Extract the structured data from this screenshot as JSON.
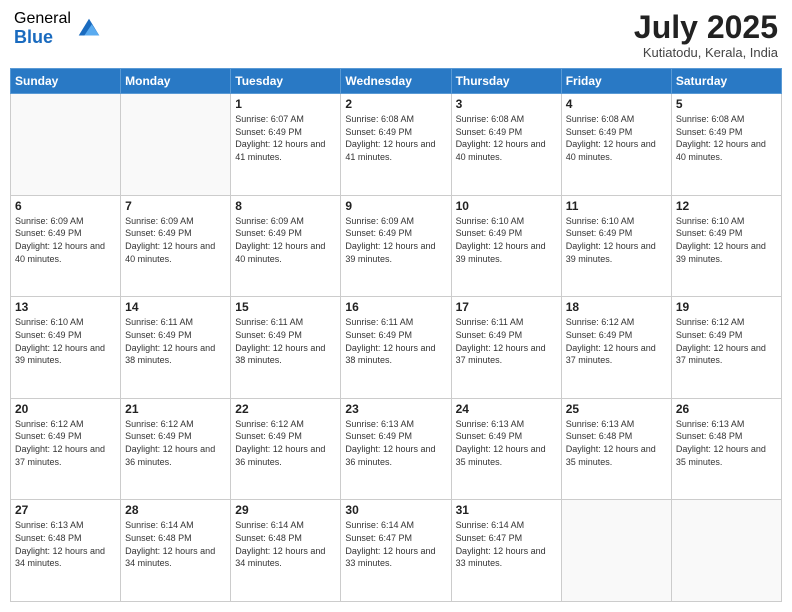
{
  "logo": {
    "general": "General",
    "blue": "Blue"
  },
  "header": {
    "month": "July 2025",
    "location": "Kutiatodu, Kerala, India"
  },
  "days": [
    "Sunday",
    "Monday",
    "Tuesday",
    "Wednesday",
    "Thursday",
    "Friday",
    "Saturday"
  ],
  "weeks": [
    [
      {
        "day": "",
        "sunrise": "",
        "sunset": "",
        "daylight": ""
      },
      {
        "day": "",
        "sunrise": "",
        "sunset": "",
        "daylight": ""
      },
      {
        "day": "1",
        "sunrise": "Sunrise: 6:07 AM",
        "sunset": "Sunset: 6:49 PM",
        "daylight": "Daylight: 12 hours and 41 minutes."
      },
      {
        "day": "2",
        "sunrise": "Sunrise: 6:08 AM",
        "sunset": "Sunset: 6:49 PM",
        "daylight": "Daylight: 12 hours and 41 minutes."
      },
      {
        "day": "3",
        "sunrise": "Sunrise: 6:08 AM",
        "sunset": "Sunset: 6:49 PM",
        "daylight": "Daylight: 12 hours and 40 minutes."
      },
      {
        "day": "4",
        "sunrise": "Sunrise: 6:08 AM",
        "sunset": "Sunset: 6:49 PM",
        "daylight": "Daylight: 12 hours and 40 minutes."
      },
      {
        "day": "5",
        "sunrise": "Sunrise: 6:08 AM",
        "sunset": "Sunset: 6:49 PM",
        "daylight": "Daylight: 12 hours and 40 minutes."
      }
    ],
    [
      {
        "day": "6",
        "sunrise": "Sunrise: 6:09 AM",
        "sunset": "Sunset: 6:49 PM",
        "daylight": "Daylight: 12 hours and 40 minutes."
      },
      {
        "day": "7",
        "sunrise": "Sunrise: 6:09 AM",
        "sunset": "Sunset: 6:49 PM",
        "daylight": "Daylight: 12 hours and 40 minutes."
      },
      {
        "day": "8",
        "sunrise": "Sunrise: 6:09 AM",
        "sunset": "Sunset: 6:49 PM",
        "daylight": "Daylight: 12 hours and 40 minutes."
      },
      {
        "day": "9",
        "sunrise": "Sunrise: 6:09 AM",
        "sunset": "Sunset: 6:49 PM",
        "daylight": "Daylight: 12 hours and 39 minutes."
      },
      {
        "day": "10",
        "sunrise": "Sunrise: 6:10 AM",
        "sunset": "Sunset: 6:49 PM",
        "daylight": "Daylight: 12 hours and 39 minutes."
      },
      {
        "day": "11",
        "sunrise": "Sunrise: 6:10 AM",
        "sunset": "Sunset: 6:49 PM",
        "daylight": "Daylight: 12 hours and 39 minutes."
      },
      {
        "day": "12",
        "sunrise": "Sunrise: 6:10 AM",
        "sunset": "Sunset: 6:49 PM",
        "daylight": "Daylight: 12 hours and 39 minutes."
      }
    ],
    [
      {
        "day": "13",
        "sunrise": "Sunrise: 6:10 AM",
        "sunset": "Sunset: 6:49 PM",
        "daylight": "Daylight: 12 hours and 39 minutes."
      },
      {
        "day": "14",
        "sunrise": "Sunrise: 6:11 AM",
        "sunset": "Sunset: 6:49 PM",
        "daylight": "Daylight: 12 hours and 38 minutes."
      },
      {
        "day": "15",
        "sunrise": "Sunrise: 6:11 AM",
        "sunset": "Sunset: 6:49 PM",
        "daylight": "Daylight: 12 hours and 38 minutes."
      },
      {
        "day": "16",
        "sunrise": "Sunrise: 6:11 AM",
        "sunset": "Sunset: 6:49 PM",
        "daylight": "Daylight: 12 hours and 38 minutes."
      },
      {
        "day": "17",
        "sunrise": "Sunrise: 6:11 AM",
        "sunset": "Sunset: 6:49 PM",
        "daylight": "Daylight: 12 hours and 37 minutes."
      },
      {
        "day": "18",
        "sunrise": "Sunrise: 6:12 AM",
        "sunset": "Sunset: 6:49 PM",
        "daylight": "Daylight: 12 hours and 37 minutes."
      },
      {
        "day": "19",
        "sunrise": "Sunrise: 6:12 AM",
        "sunset": "Sunset: 6:49 PM",
        "daylight": "Daylight: 12 hours and 37 minutes."
      }
    ],
    [
      {
        "day": "20",
        "sunrise": "Sunrise: 6:12 AM",
        "sunset": "Sunset: 6:49 PM",
        "daylight": "Daylight: 12 hours and 37 minutes."
      },
      {
        "day": "21",
        "sunrise": "Sunrise: 6:12 AM",
        "sunset": "Sunset: 6:49 PM",
        "daylight": "Daylight: 12 hours and 36 minutes."
      },
      {
        "day": "22",
        "sunrise": "Sunrise: 6:12 AM",
        "sunset": "Sunset: 6:49 PM",
        "daylight": "Daylight: 12 hours and 36 minutes."
      },
      {
        "day": "23",
        "sunrise": "Sunrise: 6:13 AM",
        "sunset": "Sunset: 6:49 PM",
        "daylight": "Daylight: 12 hours and 36 minutes."
      },
      {
        "day": "24",
        "sunrise": "Sunrise: 6:13 AM",
        "sunset": "Sunset: 6:49 PM",
        "daylight": "Daylight: 12 hours and 35 minutes."
      },
      {
        "day": "25",
        "sunrise": "Sunrise: 6:13 AM",
        "sunset": "Sunset: 6:48 PM",
        "daylight": "Daylight: 12 hours and 35 minutes."
      },
      {
        "day": "26",
        "sunrise": "Sunrise: 6:13 AM",
        "sunset": "Sunset: 6:48 PM",
        "daylight": "Daylight: 12 hours and 35 minutes."
      }
    ],
    [
      {
        "day": "27",
        "sunrise": "Sunrise: 6:13 AM",
        "sunset": "Sunset: 6:48 PM",
        "daylight": "Daylight: 12 hours and 34 minutes."
      },
      {
        "day": "28",
        "sunrise": "Sunrise: 6:14 AM",
        "sunset": "Sunset: 6:48 PM",
        "daylight": "Daylight: 12 hours and 34 minutes."
      },
      {
        "day": "29",
        "sunrise": "Sunrise: 6:14 AM",
        "sunset": "Sunset: 6:48 PM",
        "daylight": "Daylight: 12 hours and 34 minutes."
      },
      {
        "day": "30",
        "sunrise": "Sunrise: 6:14 AM",
        "sunset": "Sunset: 6:47 PM",
        "daylight": "Daylight: 12 hours and 33 minutes."
      },
      {
        "day": "31",
        "sunrise": "Sunrise: 6:14 AM",
        "sunset": "Sunset: 6:47 PM",
        "daylight": "Daylight: 12 hours and 33 minutes."
      },
      {
        "day": "",
        "sunrise": "",
        "sunset": "",
        "daylight": ""
      },
      {
        "day": "",
        "sunrise": "",
        "sunset": "",
        "daylight": ""
      }
    ]
  ]
}
